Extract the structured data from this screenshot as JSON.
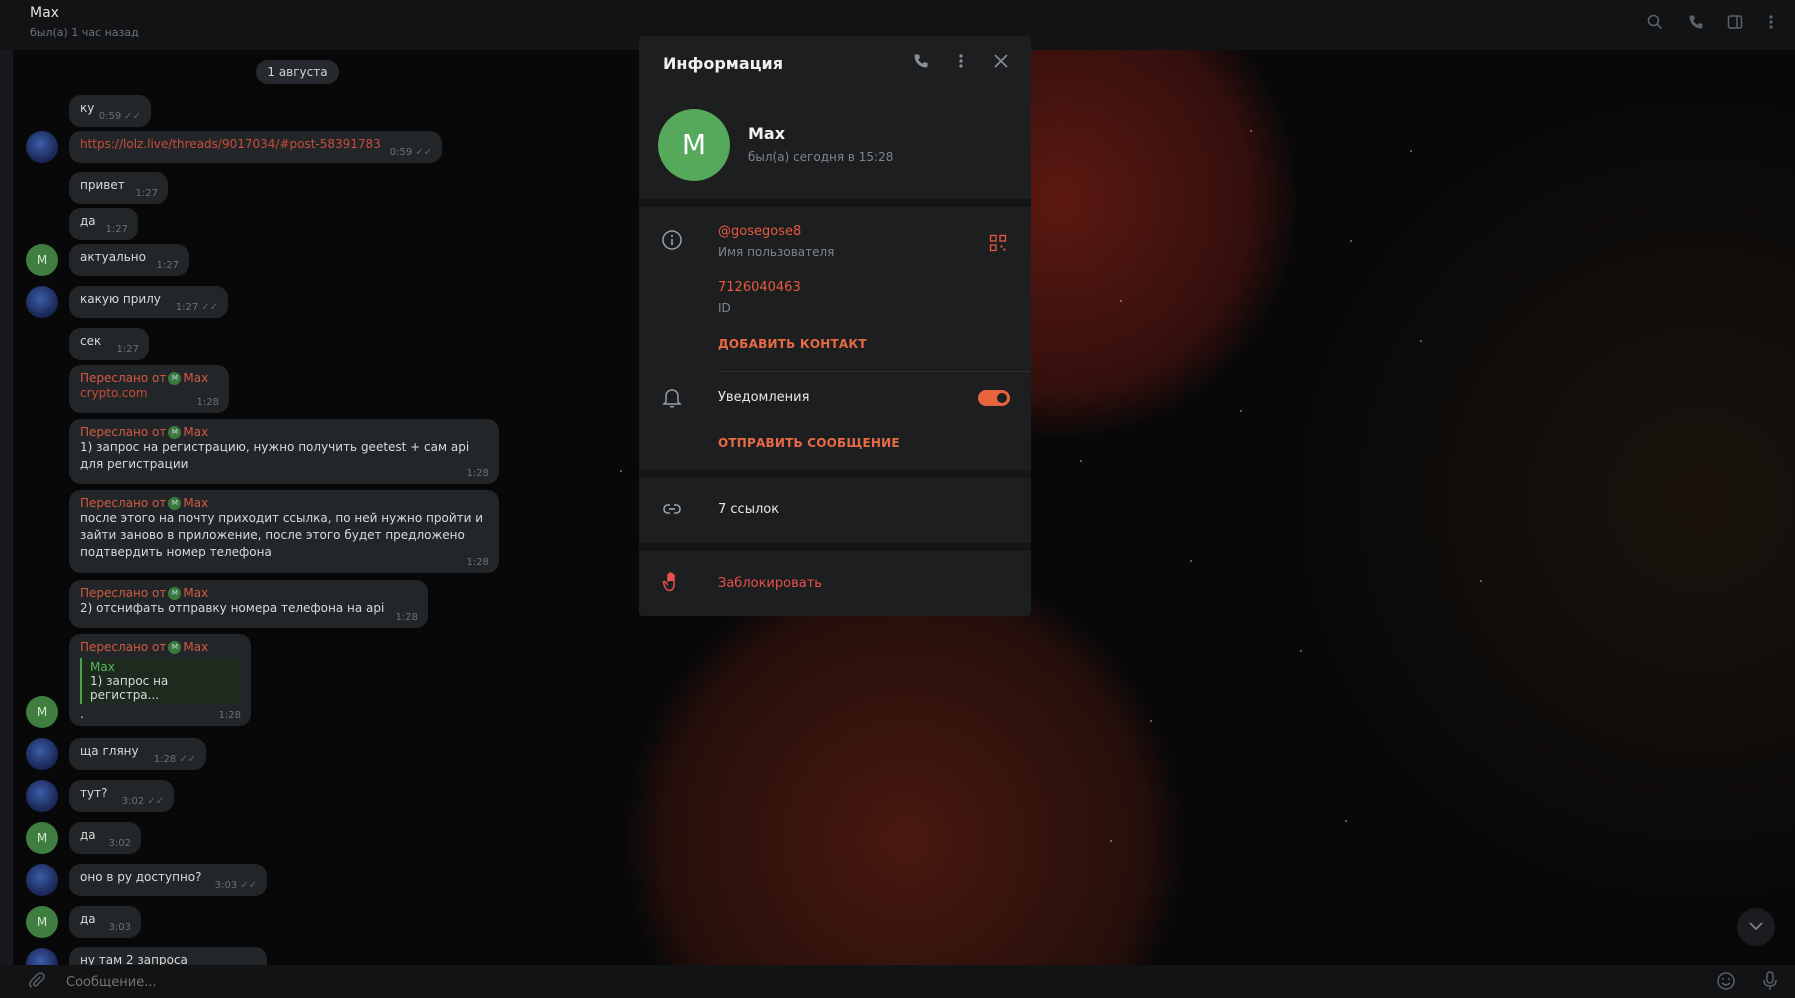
{
  "header": {
    "title": "Max",
    "status": "был(а) 1 час назад",
    "icons": [
      "search-icon",
      "phone-icon",
      "sidebar-icon",
      "menu-dots-icon"
    ]
  },
  "chat": {
    "date": "1 августа",
    "messages": [
      {
        "text": "ку",
        "time": "0:59",
        "checks": true
      },
      {
        "text": "https://lolz.live/threads/9017034/#post-58391783",
        "time": "0:59",
        "checks": true,
        "is_link": true
      },
      {
        "text": "привет",
        "time": "1:27"
      },
      {
        "text": "да",
        "time": "1:27"
      },
      {
        "text": "актуально",
        "time": "1:27"
      },
      {
        "text": "какую прилу",
        "time": "1:27",
        "checks": true
      },
      {
        "text": "сек",
        "time": "1:27"
      },
      {
        "forwarded": "Переслано от",
        "from": "Max",
        "text": "crypto.com",
        "time": "1:28",
        "is_link": true
      },
      {
        "forwarded": "Переслано от",
        "from": "Max",
        "text": "1) запрос на регистрацию, нужно получить geetest + сам api для регистрации",
        "time": "1:28"
      },
      {
        "forwarded": "Переслано от",
        "from": "Max",
        "text": "после этого на почту приходит ссылка, по ней нужно пройти и зайти заново в приложение, после этого будет предложено подтвердить номер телефона",
        "time": "1:28"
      },
      {
        "forwarded": "Переслано от",
        "from": "Max",
        "text": "2) отснифать отправку номера телефона на api",
        "time": "1:28"
      },
      {
        "forwarded": "Переслано от",
        "from": "Max",
        "reply_name": "Max",
        "reply_text": "1) запрос на регистра...",
        "text": ".",
        "time": "1:28"
      },
      {
        "text": "ща гляну",
        "time": "1:28",
        "checks": true
      },
      {
        "text": "тут?",
        "time": "3:02",
        "checks": true
      },
      {
        "text": "да",
        "time": "3:02"
      },
      {
        "text": "оно в ру доступно?",
        "time": "3:03",
        "checks": true
      },
      {
        "text": "да",
        "time": "3:03"
      },
      {
        "text": "ну там 2 запроса",
        "time": ""
      }
    ],
    "avatar_letter": "M"
  },
  "composer": {
    "placeholder": "Сообщение..."
  },
  "info": {
    "title": "Информация",
    "name": "Max",
    "avatar_letter": "M",
    "last_seen": "был(а) сегодня в 15:28",
    "username": "@gosegose8",
    "username_label": "Имя пользователя",
    "id": "7126040463",
    "id_label": "ID",
    "add_contact": "ДОБАВИТЬ КОНТАКТ",
    "notifications": "Уведомления",
    "notifications_on": true,
    "send_message": "ОТПРАВИТЬ СООБЩЕНИЕ",
    "links": "7 ссылок",
    "block": "Заблокировать"
  },
  "colors": {
    "accent": "#e85a3c",
    "avatar_green": "#56a85a",
    "panel_bg": "#1c1e20"
  }
}
